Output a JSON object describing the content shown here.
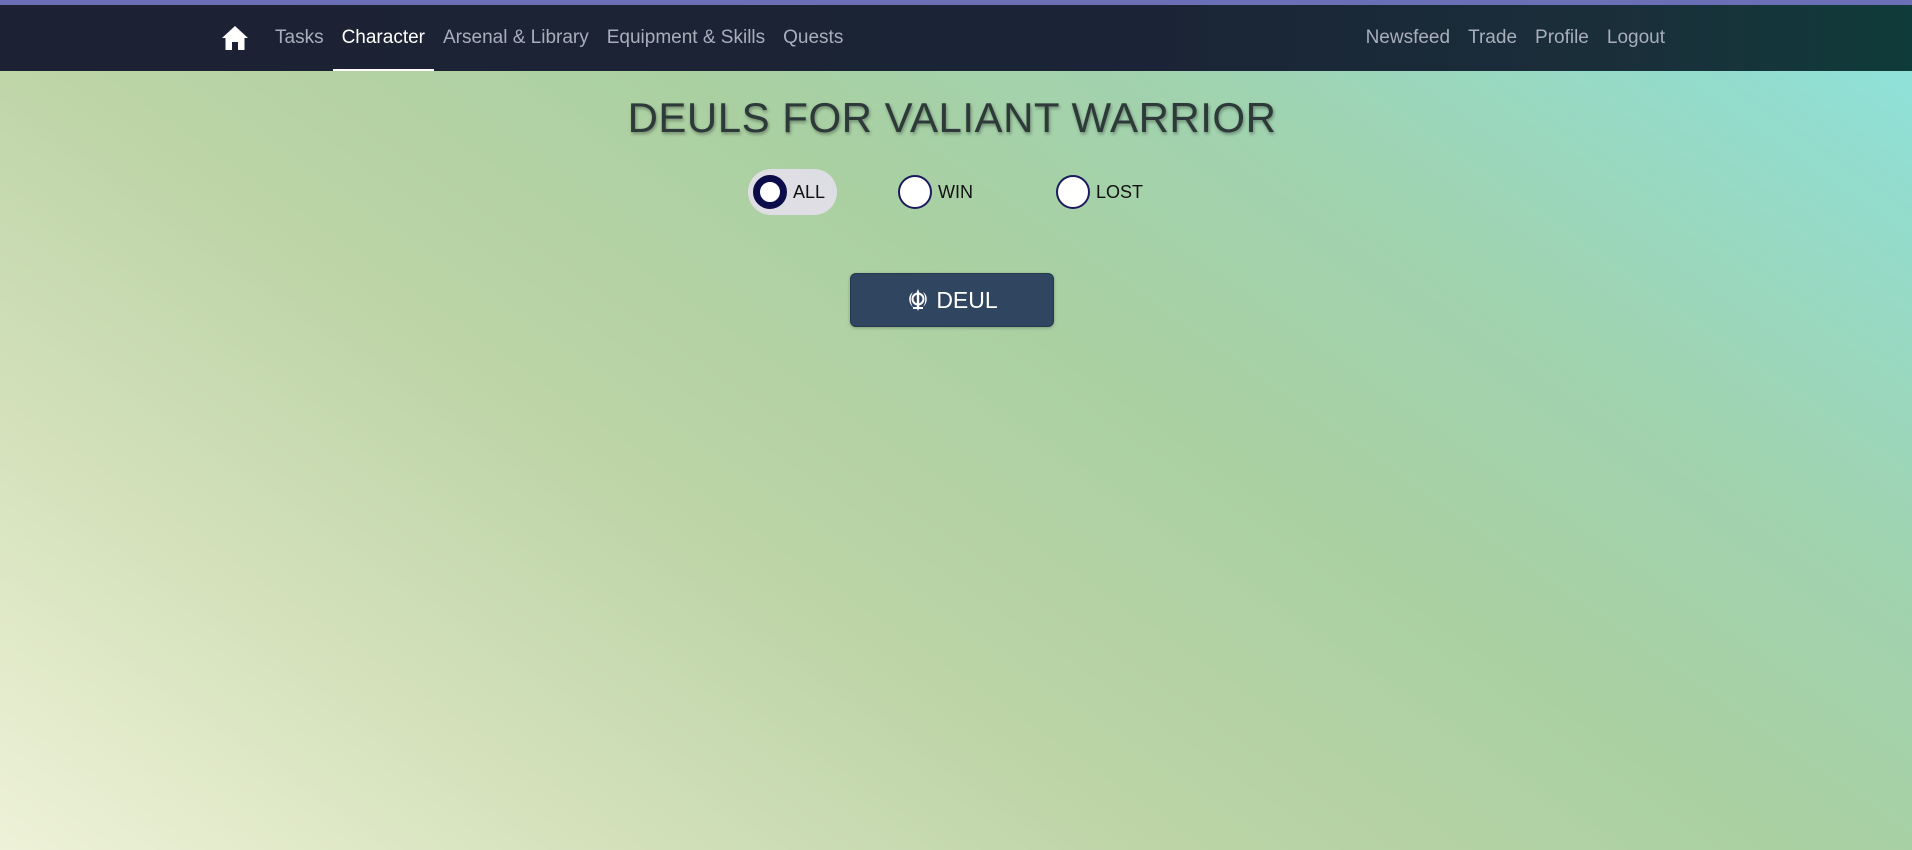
{
  "nav": {
    "home_icon": "home-icon",
    "left_links": [
      {
        "label": "Tasks",
        "active": false
      },
      {
        "label": "Character",
        "active": true
      },
      {
        "label": "Arsenal & Library",
        "active": false
      },
      {
        "label": "Equipment & Skills",
        "active": false
      },
      {
        "label": "Quests",
        "active": false
      }
    ],
    "right_links": [
      {
        "label": "Newsfeed"
      },
      {
        "label": "Trade"
      },
      {
        "label": "Profile"
      },
      {
        "label": "Logout"
      }
    ]
  },
  "main": {
    "title": "DEULS FOR VALIANT WARRIOR",
    "filters": [
      {
        "label": "ALL",
        "checked": true
      },
      {
        "label": "WIN",
        "checked": false
      },
      {
        "label": "LOST",
        "checked": false
      }
    ],
    "deul_button": {
      "label": "DEUL",
      "icon": "khanda-icon"
    }
  },
  "colors": {
    "navbar": "#1c2233",
    "accent_strip": "#6b6fb6",
    "button": "#2f4560",
    "radio": "#0c0c4a"
  }
}
